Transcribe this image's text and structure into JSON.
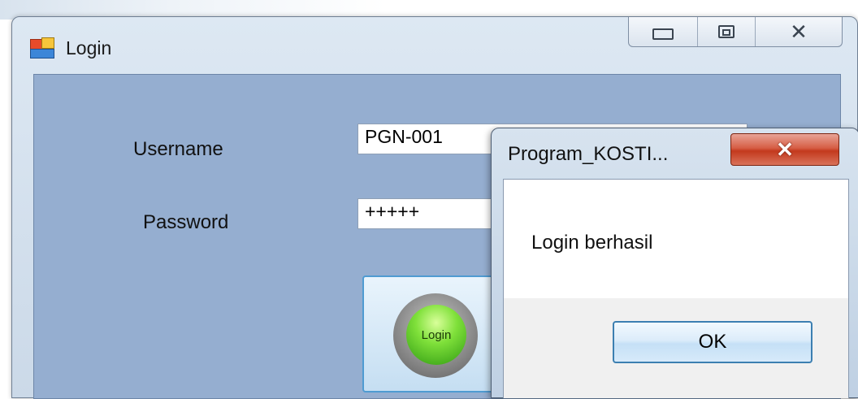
{
  "login_window": {
    "title": "Login",
    "username_label": "Username",
    "username_value": "PGN-001",
    "password_label": "Password",
    "password_value": "+++++",
    "login_button_label": "Login"
  },
  "message_box": {
    "title": "Program_KOSTI...",
    "message": "Login berhasil",
    "ok_label": "OK"
  }
}
